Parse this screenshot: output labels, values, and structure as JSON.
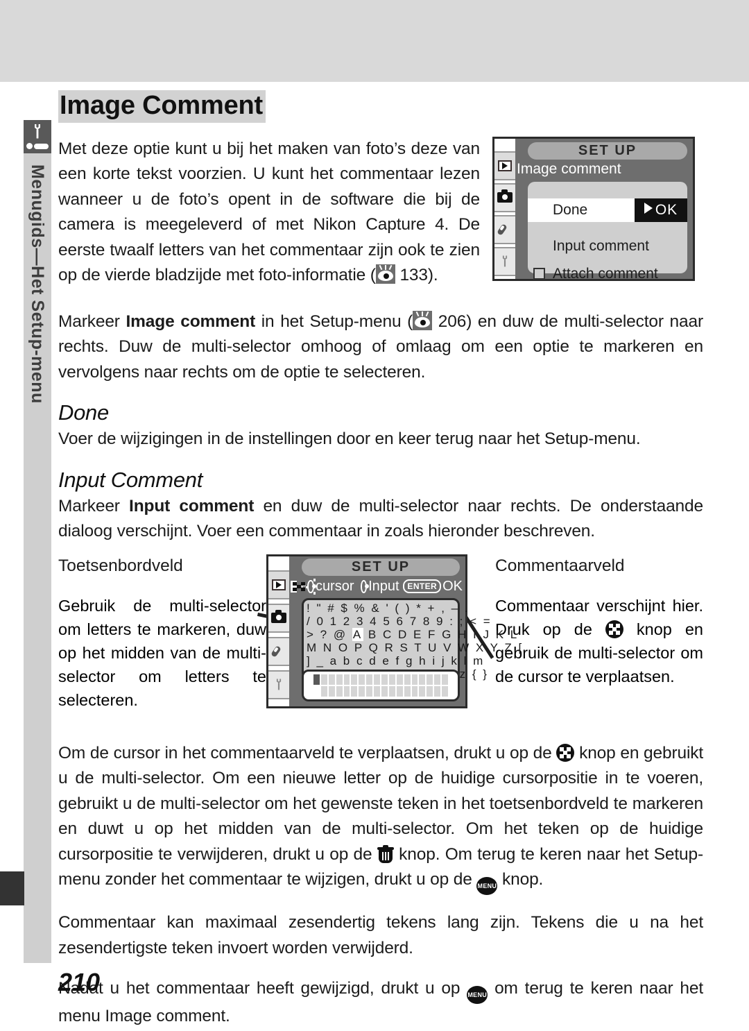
{
  "page": {
    "number": "210",
    "sidebar_label": "Menugids—Het Setup-menu",
    "sidebar_icon": "wrench-icon"
  },
  "title": "Image Comment",
  "intro": {
    "paragraph_pre": "Met deze optie kunt u bij het maken van foto’s deze van een korte tekst voorzien. U kunt het commentaar lezen wanneer u de foto’s opent in de software die bij de camera is meegeleverd of met Nikon Capture 4. De eerste twaalf letters van het commentaar zijn ook te zien op de vierde bladzijde met foto-informatie (",
    "paragraph_post": " 133)."
  },
  "markeer": {
    "pre": "Markeer ",
    "bold": "Image comment",
    "mid": " in het Setup-menu (",
    "page_ref": " 206) en duw de multi-selector naar rechts. Duw de multi-selector omhoog of omlaag om een optie te markeren en vervolgens naar rechts om de optie te selecteren."
  },
  "done": {
    "heading": "Done",
    "body": "Voer de wijzigingen in de instellingen door en keer terug naar het Setup-menu."
  },
  "input_comment": {
    "heading": "Input Comment",
    "pre": "Markeer ",
    "bold": "Input comment",
    "post": " en duw de multi-selector naar rechts. De onderstaande dialoog verschijnt. Voer een commentaar in zoals hieronder beschreven."
  },
  "keyboard_column": {
    "heading": "Toetsenbordveld",
    "body": "Gebruik de multi-selector om letters te markeren, duw op het midden van de multi-selector om letters te selecteren."
  },
  "comment_column": {
    "heading": "Commentaarveld",
    "body_pre": "Commentaar verschijnt hier. Druk op de ",
    "body_post": " knop en gebruik de multi-selector om de cursor te verplaatsen."
  },
  "cursor_paragraph": {
    "p1": "Om de cursor in het commentaarveld te verplaatsen, drukt u op de ",
    "p2": " knop en gebruikt u de multi-selector. Om een nieuwe letter op de huidige cursorpositie in te voeren, gebruikt u de multi-selector om het gewenste teken in het toetsenbordveld te markeren en duwt u op het midden van de multi-selector. Om het teken op de huidige cursorpositie te verwijderen, drukt u op de ",
    "p3": " knop. Om terug te keren naar het Setup-menu zonder het commentaar te wijzigen, drukt u op de ",
    "p4": " knop."
  },
  "limit_paragraph": "Commentaar kan maximaal zesendertig tekens lang zijn. Tekens die u na het zesendertigste teken invoert worden verwijderd.",
  "final_paragraph": {
    "pre": "Nadat u het commentaar heeft gewijzigd, drukt u op ",
    "post": " om terug te keren naar het menu Image comment."
  },
  "lcd_menu": {
    "title": "SET  UP",
    "subtitle": "Image comment",
    "rows": [
      {
        "label": "Done",
        "highlighted": true,
        "badge": "OK"
      },
      {
        "label": "Input comment",
        "highlighted": false,
        "badge": ""
      },
      {
        "label": "Attach comment",
        "highlighted": false,
        "badge": "",
        "checkbox": true
      }
    ],
    "tabs": [
      "play-icon",
      "camera-icon",
      "pencil-icon",
      "wrench-icon"
    ]
  },
  "lcd_keyboard": {
    "title": "SET  UP",
    "hint_cursor": "cursor",
    "hint_input": "Input",
    "hint_enter": "ENTER",
    "hint_ok": "OK",
    "grid_rows": [
      "!  \"  #  $  %  &  '  (  )  *  +  ,  –  .",
      "/  0  1  2  3  4  5  6  7  8  9  :  ;  <  =",
      ">  ?  @  A  B  C  D  E  F  G  H  I  J  K  L",
      "M  N  O  P  Q  R  S  T  U  V  W  X  Y  Z  [",
      "]  _  a  b  c  d  e  f  g  h  i  j  k  l  m",
      "n  o  p  q  r  s  t  u  v  w  x  y  z  {  }"
    ],
    "selected_char": "A",
    "comment_field_columns": 18,
    "comment_field_rows": 2,
    "cursor_index": 1,
    "tabs": [
      "play-icon",
      "camera-icon",
      "pencil-icon",
      "wrench-icon"
    ]
  },
  "colors": {
    "top_band": "#d9d9d9",
    "sidebar": "#cfcfcf",
    "sidebar_icon": "#595959",
    "title_highlight": "#d2d2d2",
    "lcd_body": "#6e6e6e",
    "lcd_panel": "#cfcfcf"
  }
}
